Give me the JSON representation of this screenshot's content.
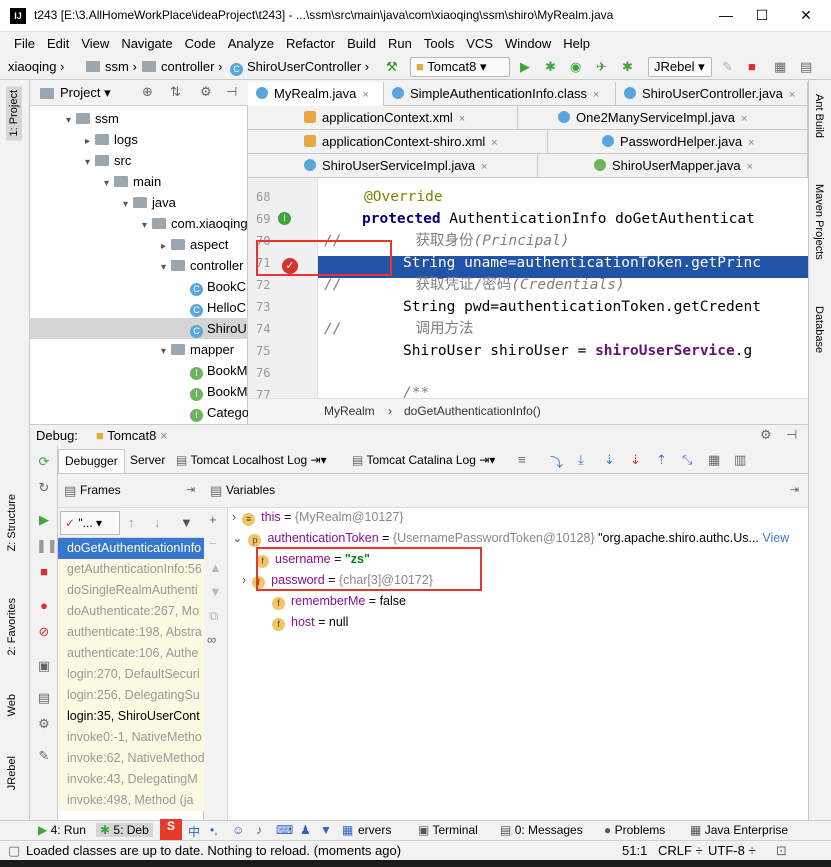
{
  "window": {
    "title": "t243 [E:\\3.AllHomeWorkPlace\\ideaProject\\t243] - ...\\ssm\\src\\main\\java\\com\\xiaoqing\\ssm\\shiro\\MyRealm.java",
    "logo": "IJ"
  },
  "menu": [
    "File",
    "Edit",
    "View",
    "Navigate",
    "Code",
    "Analyze",
    "Refactor",
    "Build",
    "Run",
    "Tools",
    "VCS",
    "Window",
    "Help"
  ],
  "nav": {
    "crumbs": [
      "xiaoqing",
      "ssm",
      "controller",
      "ShiroUserController"
    ],
    "run_config": "Tomcat8",
    "jrebel": "JRebel"
  },
  "left_strip": {
    "project": "1: Project",
    "structure": "Z: Structure",
    "favorites": "2: Favorites",
    "web": "Web",
    "jrebel": "JRebel"
  },
  "right_strip": {
    "ant": "Ant Build",
    "maven": "Maven Projects",
    "database": "Database"
  },
  "project": {
    "title": "Project",
    "tree": [
      {
        "label": "ssm",
        "kind": "folder",
        "indent": 0,
        "arrow": "▾"
      },
      {
        "label": "logs",
        "kind": "folder",
        "indent": 1,
        "arrow": "▸"
      },
      {
        "label": "src",
        "kind": "folder",
        "indent": 1,
        "arrow": "▾"
      },
      {
        "label": "main",
        "kind": "folder",
        "indent": 2,
        "arrow": "▾"
      },
      {
        "label": "java",
        "kind": "folder",
        "indent": 3,
        "arrow": "▾"
      },
      {
        "label": "com.xiaoqing",
        "kind": "folder",
        "indent": 4,
        "arrow": "▾"
      },
      {
        "label": "aspect",
        "kind": "folder",
        "indent": 5,
        "arrow": "▸"
      },
      {
        "label": "controller",
        "kind": "folder",
        "indent": 5,
        "arrow": "▾"
      },
      {
        "label": "BookC",
        "kind": "class",
        "indent": 6,
        "arrow": ""
      },
      {
        "label": "HelloC",
        "kind": "class",
        "indent": 6,
        "arrow": ""
      },
      {
        "label": "ShiroU",
        "kind": "class",
        "indent": 6,
        "arrow": "",
        "selected": true
      },
      {
        "label": "mapper",
        "kind": "folder",
        "indent": 5,
        "arrow": "▾"
      },
      {
        "label": "BookM",
        "kind": "interface",
        "indent": 6,
        "arrow": ""
      },
      {
        "label": "BookM",
        "kind": "interface",
        "indent": 6,
        "arrow": ""
      },
      {
        "label": "Catego",
        "kind": "interface",
        "indent": 6,
        "arrow": ""
      }
    ]
  },
  "editor_tabs": {
    "row1": [
      "MyRealm.java",
      "SimpleAuthenticationInfo.class",
      "ShiroUserController.java"
    ],
    "row2": [
      "applicationContext.xml",
      "One2ManyServiceImpl.java"
    ],
    "row3": [
      "applicationContext-shiro.xml",
      "PasswordHelper.java"
    ],
    "row4": [
      "ShiroUserServiceImpl.java",
      "ShiroUserMapper.java"
    ]
  },
  "code": {
    "lines": [
      "68",
      "69",
      "70",
      "71",
      "72",
      "73",
      "74",
      "75",
      "76",
      "77"
    ],
    "l68": "@Override",
    "l69_kw": "protected",
    "l69_rest": " AuthenticationInfo doGetAuthenticat",
    "l70_cmt": "//",
    "l70_text": "获取身份",
    "l70_it": "(Principal)",
    "l71_text": "String uname=authenticationToken.getPrinc",
    "l72_cmt": "//",
    "l72_text": "获取凭证/密码",
    "l72_it": "(Credentials)",
    "l73_text": "String pwd=authenticationToken.getCredent",
    "l74_cmt": "//",
    "l74_text": "调用方法",
    "l75_a": "ShiroUser shiroUser = ",
    "l75_b": "shiroUserService",
    "l75_c": ".g",
    "l77": "/**"
  },
  "breadcrumb": [
    "MyRealm",
    "doGetAuthenticationInfo()"
  ],
  "debug": {
    "label": "Debug:",
    "config": "Tomcat8",
    "tabs": [
      "Debugger",
      "Server",
      "Tomcat Localhost Log",
      "Tomcat Catalina Log"
    ],
    "frames_title": "Frames",
    "variables_title": "Variables",
    "thread": "\"...",
    "frames": [
      "doGetAuthenticationInfo",
      "getAuthenticationInfo:56",
      "doSingleRealmAuthenti",
      "doAuthenticate:267, Mo",
      "authenticate:198, Abstra",
      "authenticate:106, Authe",
      "login:270, DefaultSecuri",
      "login:256, DelegatingSu",
      "login:35, ShiroUserCont",
      "invoke0:-1, NativeMetho",
      "invoke:62, NativeMethod",
      "invoke:43, DelegatingM",
      "invoke:498, Method (ja"
    ],
    "variables": {
      "this_name": "this",
      "this_val": "{MyRealm@10127}",
      "token_name": "authenticationToken",
      "token_type": "{UsernamePasswordToken@10128}",
      "token_val": " \"org.apache.shiro.authc.Us...",
      "token_view": "View",
      "username_name": "username",
      "username_val": "\"zs\"",
      "password_name": "password",
      "password_val": "{char[3]@10172}",
      "remember_name": "rememberMe",
      "remember_val": "false",
      "host_name": "host",
      "host_val": "null"
    }
  },
  "bottom_tools": [
    "4: Run",
    "5: Deb",
    "ervers",
    "Terminal",
    "0: Messages",
    "Problems",
    "Java Enterprise"
  ],
  "status": {
    "message": "Loaded classes are up to date. Nothing to reload. (moments ago)",
    "position": "51:1",
    "crlf": "CRLF ÷",
    "encoding": "UTF-8 ÷"
  }
}
